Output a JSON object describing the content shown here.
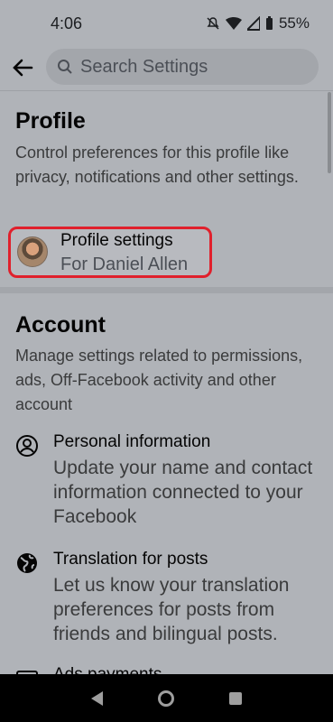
{
  "status_bar": {
    "time": "4:06",
    "battery": "55%"
  },
  "search": {
    "placeholder": "Search Settings"
  },
  "profile": {
    "title": "Profile",
    "description": "Control preferences for this profile like privacy, notifications and other settings.",
    "settings_label": "Profile settings",
    "settings_sub": "For Daniel Allen"
  },
  "account": {
    "title": "Account",
    "description": "Manage settings related to permissions, ads, Off-Facebook activity and other account",
    "items": [
      {
        "title": "Personal information",
        "desc": "Update your name and contact information connected to your Facebook",
        "icon": "person-circle-icon"
      },
      {
        "title": "Translation for posts",
        "desc": "Let us know your translation preferences for posts from friends and bilingual posts.",
        "icon": "globe-icon"
      },
      {
        "title": "Ads payments",
        "desc": "",
        "icon": "card-icon"
      }
    ]
  },
  "colors": {
    "highlight": "#e0202c",
    "overlay": "#b0b3b8"
  }
}
